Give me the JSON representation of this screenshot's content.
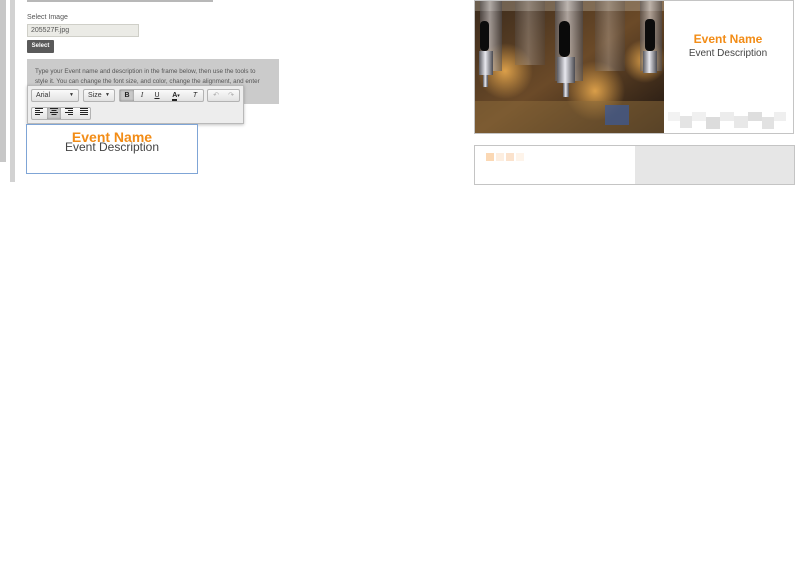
{
  "form": {
    "select_label": "Select Image",
    "file_value": "205527F.jpg",
    "select_button": "Select"
  },
  "instructions": {
    "line1": "Type your Event name and description in the frame below, then use the tools to",
    "line2": "style it. You can change the font size, and color, change the alignment, and enter"
  },
  "toolbar": {
    "font_value": "Arial",
    "size_value": "Size",
    "bold": "B",
    "italic": "I",
    "underline": "U",
    "font_color": "A",
    "remove_format": "T",
    "undo": "↶",
    "redo": "↷",
    "align_left_active": false,
    "align_center_active": true,
    "bold_active": true
  },
  "editor": {
    "event_name": "Event Name",
    "event_description": "Event Description"
  },
  "preview": {
    "event_name": "Event Name",
    "event_description": "Event Description",
    "accent_color": "#f28c16"
  }
}
